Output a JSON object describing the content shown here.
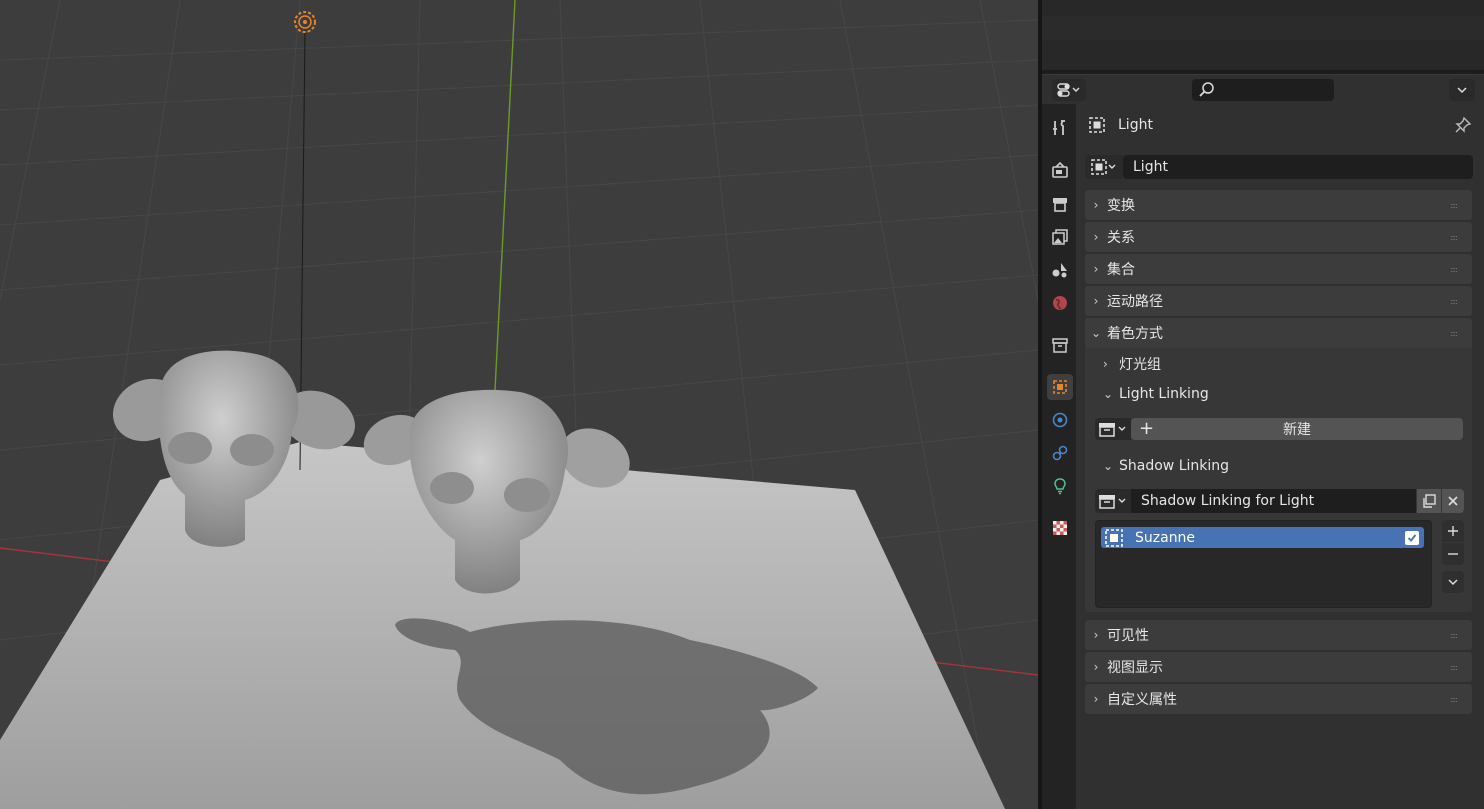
{
  "properties": {
    "object_header": {
      "name": "Light"
    },
    "object_name_field": {
      "value": "Light"
    },
    "panels": [
      {
        "label": "变换",
        "expanded": false
      },
      {
        "label": "关系",
        "expanded": false
      },
      {
        "label": "集合",
        "expanded": false
      },
      {
        "label": "运动路径",
        "expanded": false
      },
      {
        "label": "着色方式",
        "expanded": true
      },
      {
        "label": "可见性",
        "expanded": false
      },
      {
        "label": "视图显示",
        "expanded": false
      },
      {
        "label": "自定义属性",
        "expanded": false
      }
    ],
    "shading": {
      "light_groups_label": "灯光组",
      "light_linking_label": "Light Linking",
      "new_button_label": "新建",
      "shadow_linking_label": "Shadow Linking",
      "shadow_collection_value": "Shadow Linking for Light",
      "list_items": [
        {
          "name": "Suzanne",
          "checked": true
        }
      ]
    }
  },
  "tabs": [
    "tool-icon",
    "render-icon",
    "output-icon",
    "view-layer-icon",
    "scene-icon",
    "world-icon",
    "collection-icon",
    "object-icon",
    "modifiers-icon",
    "physics-icon",
    "constraints-icon",
    "data-light-icon",
    "texture-icon"
  ],
  "colors": {
    "accent_orange": "#e8842a",
    "selection_blue": "#4772b3",
    "axis_x": "#a5353b",
    "axis_y": "#6a9a2a"
  }
}
